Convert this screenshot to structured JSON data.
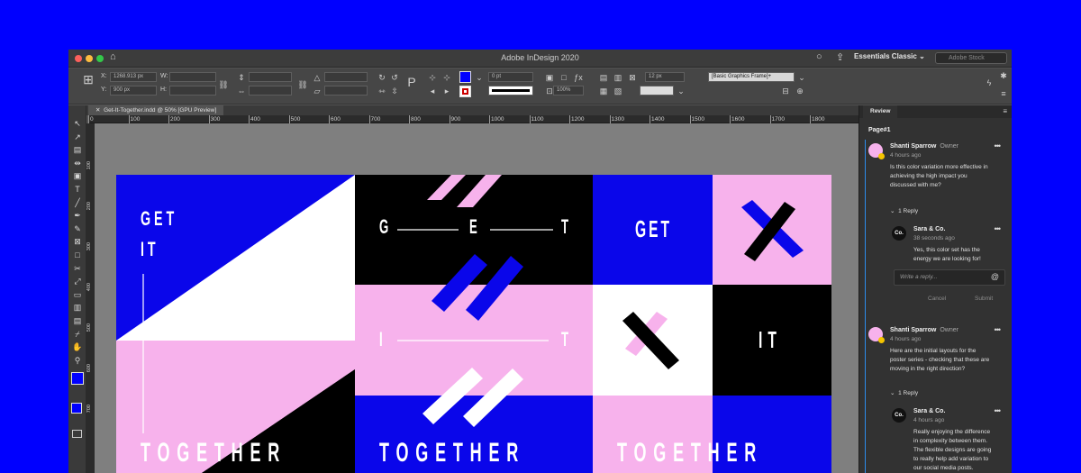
{
  "window": {
    "title": "Adobe InDesign 2020",
    "workspace": "Essentials Classic",
    "search_placeholder": "Adobe Stock"
  },
  "control": {
    "x_label": "X:",
    "x": "1268.913 px",
    "y_label": "Y:",
    "y": "900 px",
    "w_label": "W:",
    "h_label": "H:",
    "stroke": "0 pt",
    "zoom": "100%",
    "fit": "12 px",
    "style": "[Basic Graphics Frame]+",
    "fill_color": "#0000ff"
  },
  "tab": {
    "label": "Get-It-Together.indd @ 50% [GPU Preview]"
  },
  "ruler": {
    "h": [
      "0",
      "100",
      "200",
      "300",
      "400",
      "500",
      "600",
      "700",
      "800",
      "900",
      "1000",
      "1100",
      "1200",
      "1300",
      "1400",
      "1500",
      "1600",
      "1700",
      "1800"
    ],
    "v": [
      "100",
      "200",
      "300",
      "400",
      "500",
      "600",
      "700"
    ]
  },
  "poster": {
    "get": "GET",
    "it": "IT",
    "together": "TOGETHER",
    "g": "G",
    "e": "E",
    "t": "T",
    "i": "I",
    "colors": {
      "blue": "#0a06ea",
      "pink": "#f7b2ec",
      "black": "#000000",
      "white": "#ffffff"
    }
  },
  "review": {
    "tab": "Review",
    "page": "Page#1",
    "c1": {
      "name": "Shanti Sparrow",
      "role": "Owner",
      "time": "4 hours ago",
      "text": [
        "Is this color variation more effective in",
        "achieving the high impact you",
        "discussed with me?"
      ],
      "replies": "1 Reply"
    },
    "r1": {
      "name": "Sara & Co.",
      "time": "38 seconds ago",
      "text": [
        "Yes, this color set has the",
        "energy we are looking for!"
      ]
    },
    "reply_placeholder": "Write a reply...",
    "cancel": "Cancel",
    "submit": "Submit",
    "c2": {
      "name": "Shanti Sparrow",
      "role": "Owner",
      "time": "4 hours ago",
      "text": [
        "Here are the initial layouts for the",
        "poster series - checking that these are",
        "moving in the right direction?"
      ],
      "replies": "1 Reply"
    },
    "r2": {
      "name": "Sara & Co.",
      "time": "4 hours ago",
      "text": [
        "Really enjoying the difference",
        "in complexity between them.",
        "The flexible designs are going",
        "to really help add variation to",
        "our social media posts."
      ]
    }
  }
}
